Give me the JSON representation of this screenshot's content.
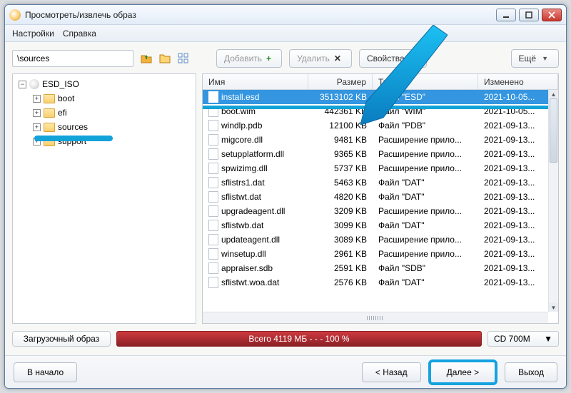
{
  "window": {
    "title": "Просмотреть/извлечь образ"
  },
  "menu": {
    "settings": "Настройки",
    "help": "Справка"
  },
  "path": "\\sources",
  "toolbar": {
    "add": "Добавить",
    "remove": "Удалить",
    "props": "Свойства",
    "more": "Ещё"
  },
  "tree": {
    "root": "ESD_ISO",
    "items": [
      "boot",
      "efi",
      "sources",
      "support"
    ]
  },
  "columns": {
    "name": "Имя",
    "size": "Размер",
    "type": "Тип",
    "modified": "Изменено"
  },
  "files": [
    {
      "name": "install.esd",
      "size": "3513102 KB",
      "type": "Файл \"ESD\"",
      "mod": "2021-10-05...",
      "selected": true
    },
    {
      "name": "boot.wim",
      "size": "442361 KB",
      "type": "Файл \"WIM\"",
      "mod": "2021-10-05..."
    },
    {
      "name": "windlp.pdb",
      "size": "12100 KB",
      "type": "Файл \"PDB\"",
      "mod": "2021-09-13..."
    },
    {
      "name": "migcore.dll",
      "size": "9481 KB",
      "type": "Расширение прило...",
      "mod": "2021-09-13..."
    },
    {
      "name": "setupplatform.dll",
      "size": "9365 KB",
      "type": "Расширение прило...",
      "mod": "2021-09-13..."
    },
    {
      "name": "spwizimg.dll",
      "size": "5737 KB",
      "type": "Расширение прило...",
      "mod": "2021-09-13..."
    },
    {
      "name": "sflistrs1.dat",
      "size": "5463 KB",
      "type": "Файл \"DAT\"",
      "mod": "2021-09-13..."
    },
    {
      "name": "sflistwt.dat",
      "size": "4820 KB",
      "type": "Файл \"DAT\"",
      "mod": "2021-09-13..."
    },
    {
      "name": "upgradeagent.dll",
      "size": "3209 KB",
      "type": "Расширение прило...",
      "mod": "2021-09-13..."
    },
    {
      "name": "sflistwb.dat",
      "size": "3099 KB",
      "type": "Файл \"DAT\"",
      "mod": "2021-09-13..."
    },
    {
      "name": "updateagent.dll",
      "size": "3089 KB",
      "type": "Расширение прило...",
      "mod": "2021-09-13..."
    },
    {
      "name": "winsetup.dll",
      "size": "2961 KB",
      "type": "Расширение прило...",
      "mod": "2021-09-13..."
    },
    {
      "name": "appraiser.sdb",
      "size": "2591 KB",
      "type": "Файл \"SDB\"",
      "mod": "2021-09-13..."
    },
    {
      "name": "sflistwt.woa.dat",
      "size": "2576 KB",
      "type": "Файл \"DAT\"",
      "mod": "2021-09-13..."
    }
  ],
  "status": {
    "boot_label": "Загрузочный образ",
    "bar_text": "Всего  4119 МБ   - - -   100 %",
    "media": "CD 700M"
  },
  "footer": {
    "begin": "В начало",
    "back": "< Назад",
    "next": "Далее >",
    "exit": "Выход"
  }
}
